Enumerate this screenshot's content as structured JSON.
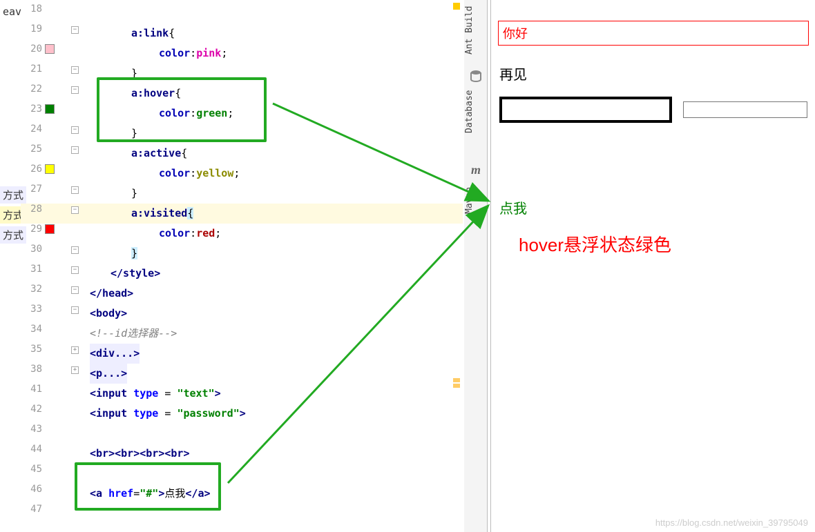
{
  "left_truncated": [
    "eav",
    "方式",
    "方式",
    "方式"
  ],
  "lines": [
    {
      "n": 18
    },
    {
      "n": 19,
      "swatch": "#FFC0CB"
    },
    {
      "n": 20
    },
    {
      "n": 21
    },
    {
      "n": 22
    },
    {
      "n": 23,
      "swatch": "#008000"
    },
    {
      "n": 24
    },
    {
      "n": 25
    },
    {
      "n": 26,
      "swatch": "#FFFF00"
    },
    {
      "n": 27
    },
    {
      "n": 28,
      "highlight": true
    },
    {
      "n": 29,
      "swatch": "#FF0000"
    },
    {
      "n": 30
    },
    {
      "n": 31
    },
    {
      "n": 32
    },
    {
      "n": 33
    },
    {
      "n": 34
    },
    {
      "n": 35
    },
    {
      "n": 38
    },
    {
      "n": 41
    },
    {
      "n": 42
    },
    {
      "n": 43
    },
    {
      "n": 44
    },
    {
      "n": 45
    },
    {
      "n": 46
    },
    {
      "n": 47
    }
  ],
  "code": {
    "l18": {
      "indent": "            "
    },
    "l19": {
      "indent": "            ",
      "sel": "a",
      "pseudo": ":link",
      "brace": "{"
    },
    "l20": {
      "indent": "                ",
      "prop": "color",
      "sep": ":",
      "val": "pink",
      "term": ";"
    },
    "l21": {
      "indent": "            ",
      "brace": "}"
    },
    "l22": {
      "indent": "            ",
      "sel": "a",
      "pseudo": ":hover",
      "brace": "{"
    },
    "l23": {
      "indent": "                ",
      "prop": "color",
      "sep": ":",
      "val": "green",
      "term": ";"
    },
    "l24": {
      "indent": "            ",
      "brace": "}"
    },
    "l25": {
      "indent": "            ",
      "sel": "a",
      "pseudo": ":active",
      "brace": "{"
    },
    "l26": {
      "indent": "                ",
      "prop": "color",
      "sep": ":",
      "val": "yellow",
      "term": ";"
    },
    "l27": {
      "indent": "            ",
      "brace": "}"
    },
    "l28": {
      "indent": "            ",
      "sel": "a",
      "pseudo": ":visited",
      "brace": "{"
    },
    "l29": {
      "indent": "                ",
      "prop": "color",
      "sep": ":",
      "val": "red",
      "term": ";"
    },
    "l30": {
      "indent": "            ",
      "brace": "}"
    },
    "l31": {
      "indent": "    ",
      "close_tag": "</style>"
    },
    "l32": {
      "indent": "",
      "close_tag": "</head>"
    },
    "l33": {
      "indent": "",
      "open_tag": "<body>"
    },
    "l34": {
      "indent": "",
      "comment": "<!--id选择器-->"
    },
    "l35": {
      "indent": "",
      "folded": "<div...>"
    },
    "l38": {
      "indent": "",
      "folded": "<p...>"
    },
    "l41": {
      "indent": "",
      "tag_open": "<input ",
      "attr": "type",
      "eq": " = ",
      "val": "\"text\"",
      "tag_close": ">"
    },
    "l42": {
      "indent": "",
      "tag_open": "<input ",
      "attr": "type",
      "eq": " = ",
      "val": "\"password\"",
      "tag_close": ">"
    },
    "l44": {
      "indent": "",
      "br": "<br><br><br><br>"
    },
    "l46": {
      "indent": "",
      "a_open": "<a ",
      "a_attr": "href",
      "a_eq": "=",
      "a_val": "\"#\"",
      "a_gt": ">",
      "a_text": "点我",
      "a_close": "</a>"
    }
  },
  "side_tabs": {
    "t1": "Ant Build",
    "t2": "Database",
    "t3": "Maven"
  },
  "preview": {
    "hello": "你好",
    "bye": "再见",
    "link_text": "点我"
  },
  "annotation": "hover悬浮状态绿色",
  "watermark": "https://blog.csdn.net/weixin_39795049"
}
